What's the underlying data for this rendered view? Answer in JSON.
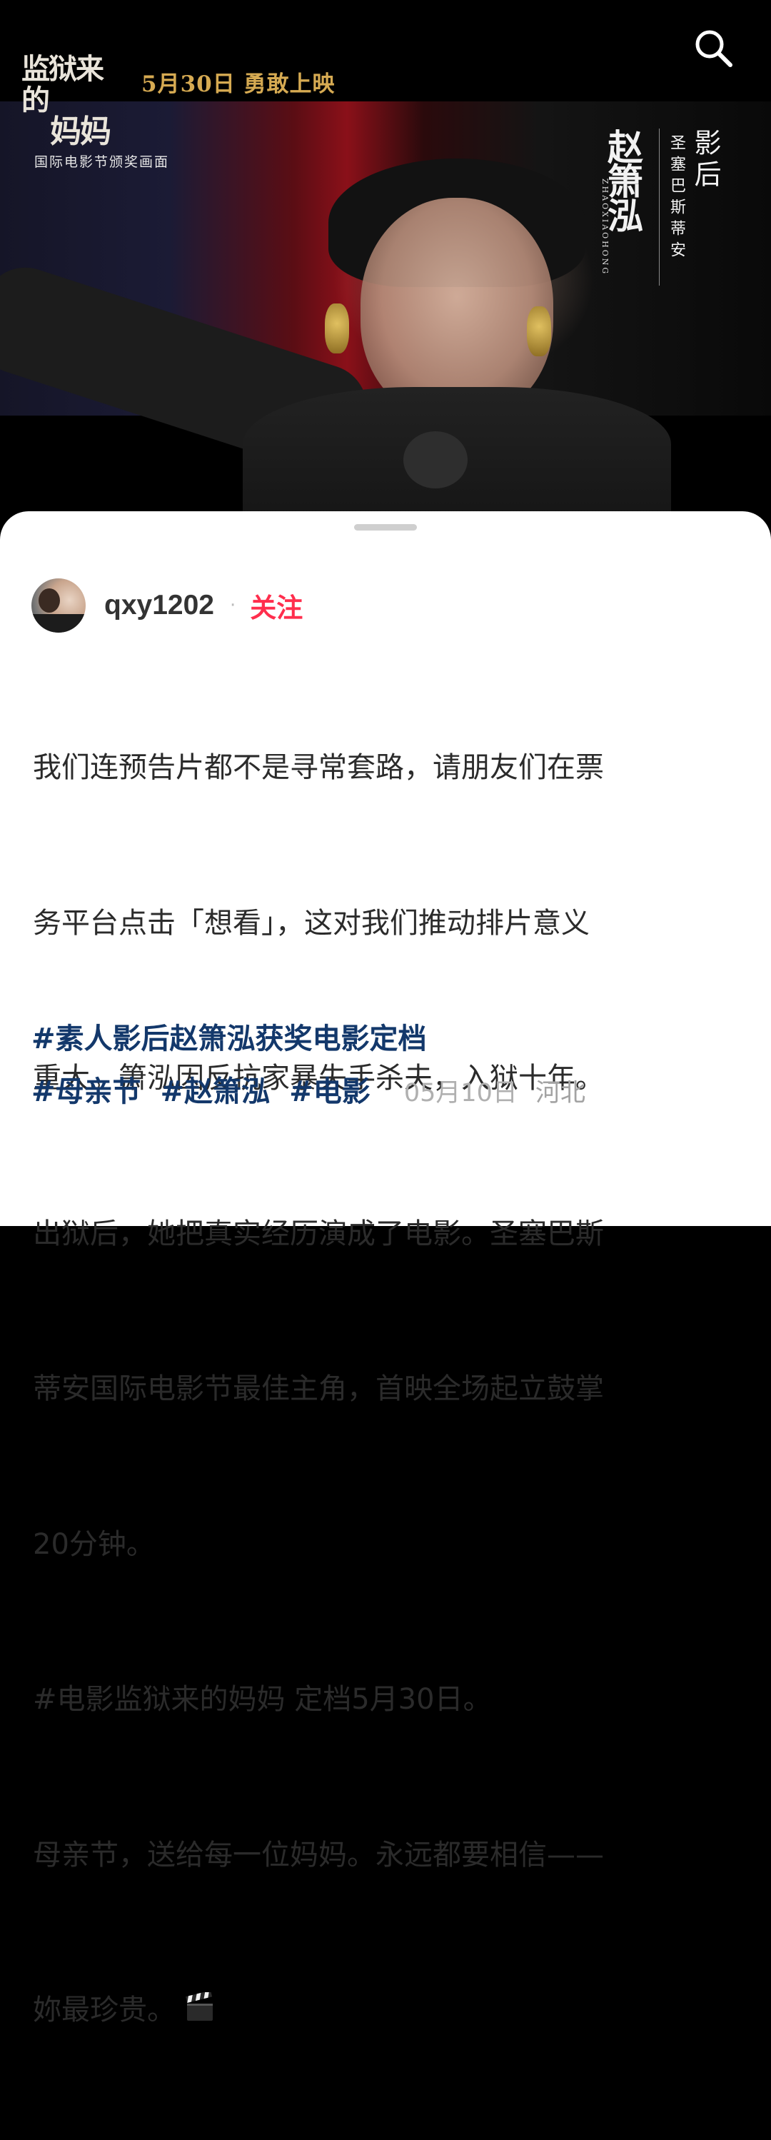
{
  "video": {
    "movie_title_line1": "监狱来的",
    "movie_title_line2": "妈妈",
    "release_text": "5月30日  勇敢上映",
    "caption": "国际电影节颁奖画面",
    "credit": {
      "name": "赵箫泓",
      "pinyin": "ZHAOXIAOHONG",
      "festival": "圣塞巴斯蒂安",
      "award": "影后"
    },
    "search_icon": "search-icon"
  },
  "post": {
    "author": {
      "username": "qxy1202",
      "separator": "·",
      "follow_label": "关注",
      "avatar_icon": "avatar"
    },
    "body_lines": [
      "我们连预告片都不是寻常套路，请朋友们在票",
      "务平台点击「想看」，这对我们推动排片意义",
      "重大。箫泓因反抗家暴失手杀夫，入狱十年。",
      "出狱后，她把真实经历演成了电影。圣塞巴斯",
      "蒂安国际电影节最佳主角，首映全场起立鼓掌",
      "20分钟。",
      "#电影监狱来的妈妈 定档5月30日。",
      "母亲节，送给每一位妈妈。永远都要相信——",
      "妳最珍贵。"
    ],
    "trailing_icon": "clapper-board-icon",
    "tags_row1": [
      "#素人影后赵箫泓获奖电影定档"
    ],
    "tags_row2": [
      "#母亲节",
      "#赵箫泓",
      "#电影"
    ],
    "date": "05月10日",
    "location": "河北"
  },
  "colors": {
    "accent_follow": "#ff2e4d",
    "hashtag": "#13386b",
    "release_gold": "#d6aa52"
  }
}
